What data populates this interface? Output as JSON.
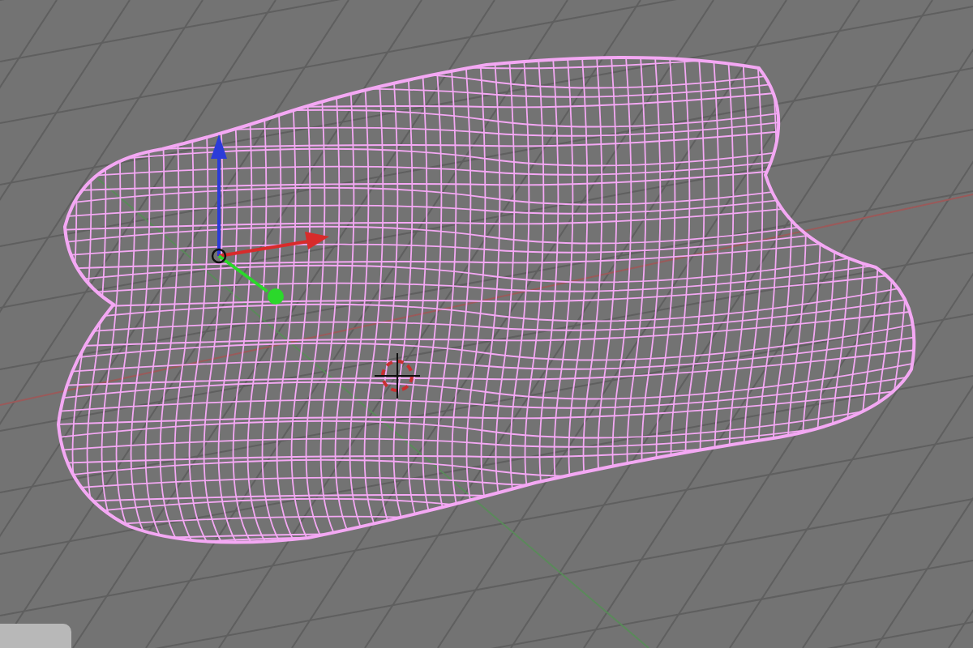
{
  "mesh": {
    "selected": true
  }
}
